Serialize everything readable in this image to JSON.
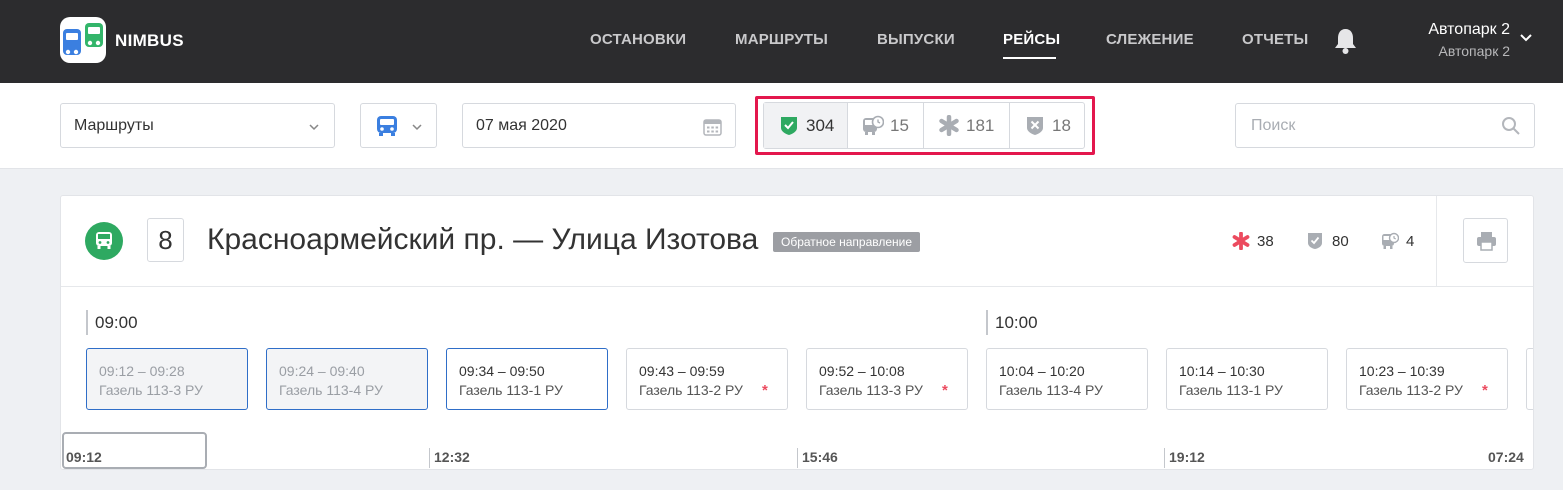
{
  "header": {
    "brand": "NIMBUS",
    "nav": [
      {
        "label": "ОСТАНОВКИ",
        "active": false
      },
      {
        "label": "МАРШРУТЫ",
        "active": false
      },
      {
        "label": "ВЫПУСКИ",
        "active": false
      },
      {
        "label": "РЕЙСЫ",
        "active": true
      },
      {
        "label": "СЛЕЖЕНИЕ",
        "active": false
      },
      {
        "label": "ОТЧЕТЫ",
        "active": false
      }
    ],
    "account": {
      "name": "Автопарк 2",
      "sub": "Автопарк 2"
    }
  },
  "toolbar": {
    "routes_select": "Маршруты",
    "date": "07 мая 2020",
    "filters": [
      {
        "icon": "shield-check-icon",
        "count": "304",
        "selected": true
      },
      {
        "icon": "bus-clock-icon",
        "count": "15",
        "selected": false
      },
      {
        "icon": "asterisk-icon",
        "count": "181",
        "selected": false
      },
      {
        "icon": "shield-cross-icon",
        "count": "18",
        "selected": false
      }
    ],
    "search_placeholder": "Поиск"
  },
  "route": {
    "number": "8",
    "title": "Красноармейский пр. — Улица Изотова",
    "direction": "Обратное направление",
    "stats": [
      {
        "icon": "asterisk-icon",
        "value": "38"
      },
      {
        "icon": "shield-check-icon",
        "value": "80"
      },
      {
        "icon": "bus-clock-icon",
        "value": "4"
      }
    ],
    "hours": [
      "09:00",
      "10:00"
    ],
    "trips": [
      {
        "time": "09:12 – 09:28",
        "bus": "Газель 113-3 РУ",
        "state": "past",
        "flag": ""
      },
      {
        "time": "09:24 – 09:40",
        "bus": "Газель 113-4 РУ",
        "state": "past",
        "flag": ""
      },
      {
        "time": "09:34 – 09:50",
        "bus": "Газель 113-1 РУ",
        "state": "current",
        "flag": ""
      },
      {
        "time": "09:43 – 09:59",
        "bus": "Газель 113-2 РУ",
        "state": "",
        "flag": "*"
      },
      {
        "time": "09:52 – 10:08",
        "bus": "Газель 113-3 РУ",
        "state": "",
        "flag": "*"
      },
      {
        "time": "10:04 – 10:20",
        "bus": "Газель 113-4 РУ",
        "state": "",
        "flag": ""
      },
      {
        "time": "10:14 – 10:30",
        "bus": "Газель 113-1 РУ",
        "state": "",
        "flag": ""
      },
      {
        "time": "10:23 – 10:39",
        "bus": "Газель 113-2 РУ",
        "state": "",
        "flag": "*"
      }
    ],
    "timeline": [
      "09:12",
      "12:32",
      "15:46",
      "19:12",
      "07:24"
    ]
  },
  "colors": {
    "header_bg": "#2c2c2e",
    "accent_blue": "#2f6ec8",
    "route_green": "#2ea961",
    "alert_red": "#ec4b5f",
    "highlight": "#e3174d"
  }
}
